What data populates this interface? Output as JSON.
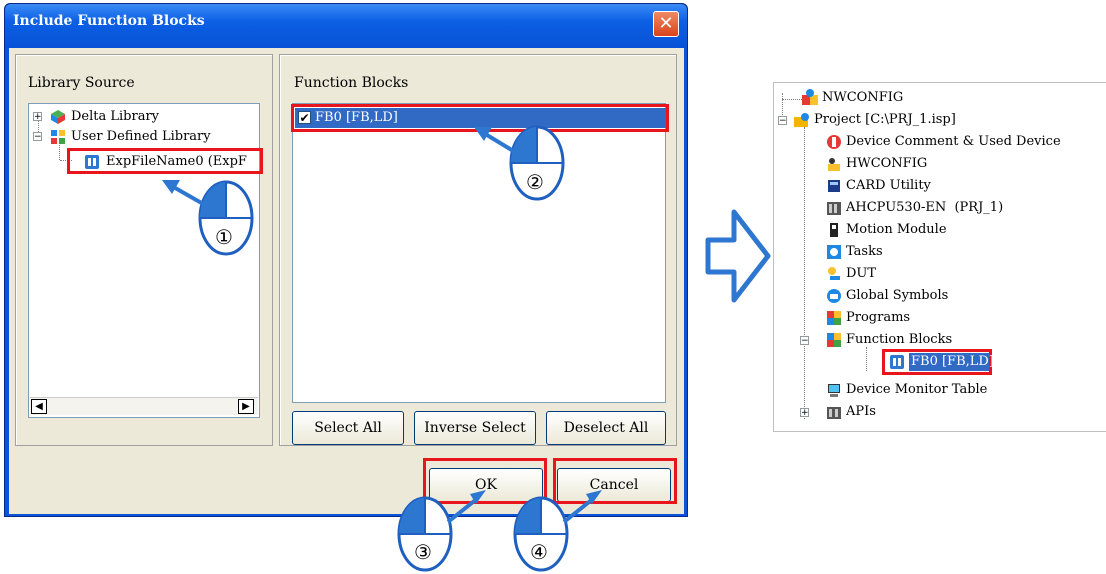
{
  "dialog": {
    "title": "Include Function Blocks",
    "close_glyph": "✕",
    "library_source": {
      "heading": "Library Source",
      "items": [
        {
          "label": "Delta Library",
          "expander": "+"
        },
        {
          "label": "User Defined Library",
          "expander": "−"
        },
        {
          "label": "ExpFileName0 (ExpF"
        }
      ]
    },
    "function_blocks": {
      "heading": "Function Blocks",
      "items": [
        {
          "label": "FB0 [FB,LD]",
          "checked": true
        }
      ]
    },
    "buttons": {
      "select_all": "Select All",
      "inverse_select": "Inverse Select",
      "deselect_all": "Deselect All",
      "ok": "OK",
      "cancel": "Cancel"
    }
  },
  "steps": [
    "①",
    "②",
    "③",
    "④"
  ],
  "project_tree": {
    "items": [
      {
        "label": "NWCONFIG"
      },
      {
        "label": "Project [C:\\PRJ_1.isp]",
        "expander": "−"
      },
      {
        "label": "Device Comment & Used Device"
      },
      {
        "label": "HWCONFIG"
      },
      {
        "label": "CARD Utility"
      },
      {
        "label": "AHCPU530-EN  (PRJ_1)"
      },
      {
        "label": "Motion Module"
      },
      {
        "label": "Tasks"
      },
      {
        "label": "DUT"
      },
      {
        "label": "Global Symbols"
      },
      {
        "label": "Programs"
      },
      {
        "label": "Function Blocks",
        "expander": "−"
      },
      {
        "label": "FB0 [FB,LD]"
      },
      {
        "label": "Device Monitor Table"
      },
      {
        "label": "APIs",
        "expander": "+"
      }
    ]
  },
  "colors": {
    "highlight_red": "#e8161c",
    "arrow_blue": "#2e77d0",
    "selection_blue": "#316ac5"
  }
}
